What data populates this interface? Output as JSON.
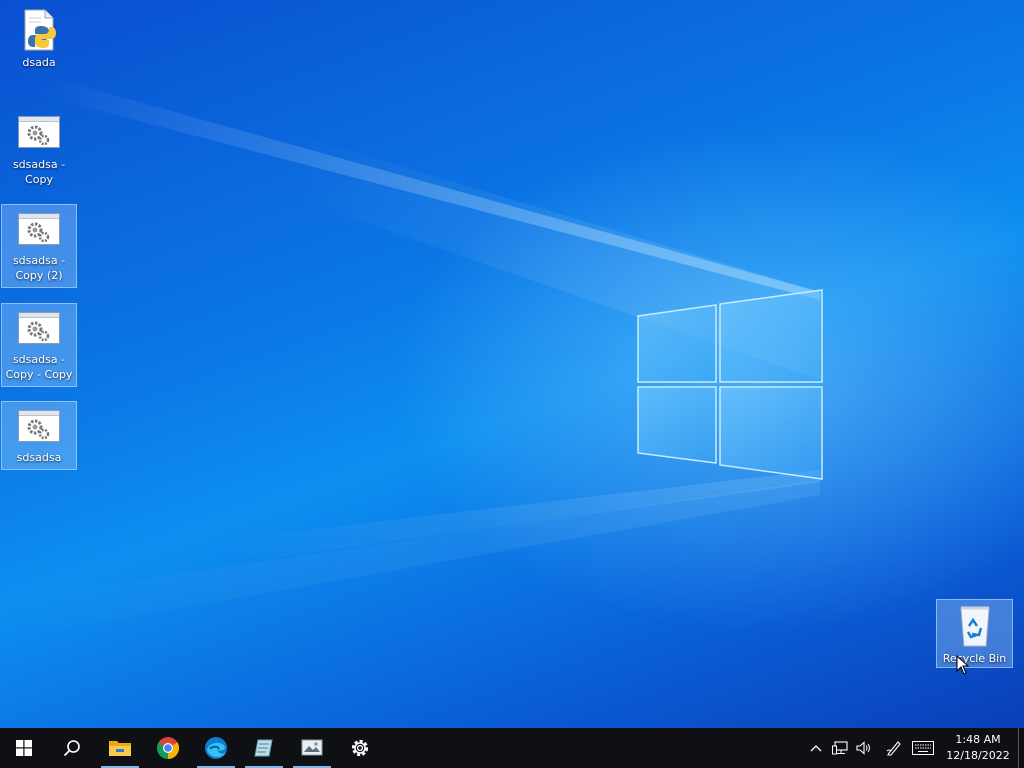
{
  "desktop": {
    "icons": [
      {
        "label": "dsada",
        "type": "python-file"
      },
      {
        "label": "sdsadsa - Copy",
        "type": "application"
      },
      {
        "label": "sdsadsa - Copy (2)",
        "type": "application"
      },
      {
        "label": "sdsadsa - Copy - Copy",
        "type": "application"
      },
      {
        "label": "sdsadsa",
        "type": "application"
      }
    ],
    "recycle_bin": {
      "label": "Recycle Bin"
    }
  },
  "taskbar": {
    "pinned": [
      "start-icon",
      "search-icon",
      "file-explorer-icon",
      "chrome-icon",
      "edge-icon",
      "notepad-app-icon",
      "photo-app-icon",
      "settings-icon"
    ],
    "tray": [
      "chevron-up-icon",
      "network-icon",
      "volume-icon",
      "pen-icon",
      "keyboard-icon"
    ]
  },
  "clock": {
    "time": "1:48 AM",
    "date": "12/18/2022"
  },
  "colors": {
    "taskbar": "#0f1014",
    "accent": "#0a63d8"
  }
}
